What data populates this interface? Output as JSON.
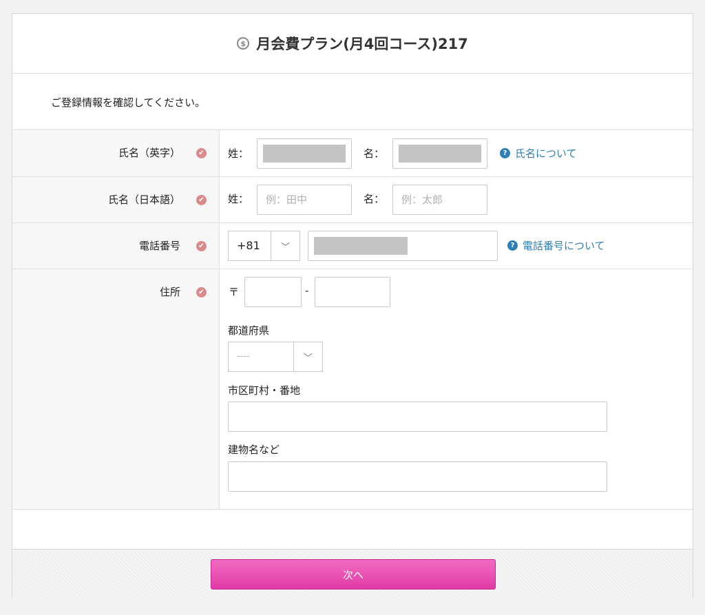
{
  "header": {
    "plan_icon": "dollar-circle-icon",
    "title": "月会費プラン(月4回コース)217"
  },
  "intro": "ご登録情報を確認してください。",
  "rows": {
    "name_en": {
      "label": "氏名（英字）",
      "last_label": "姓：",
      "first_label": "名：",
      "help": "氏名について"
    },
    "name_ja": {
      "label": "氏名（日本語）",
      "last_label": "姓：",
      "first_label": "名：",
      "last_placeholder": "例：田中",
      "first_placeholder": "例：太郎"
    },
    "phone": {
      "label": "電話番号",
      "country_code": "+81",
      "help": "電話番号について"
    },
    "address": {
      "label": "住所",
      "postal_mark": "〒",
      "postal_sep": "-",
      "prefecture_label": "都道府県",
      "prefecture_value": "----",
      "city_label": "市区町村・番地",
      "building_label": "建物名など"
    }
  },
  "required_icon": "check-circle-icon",
  "help_icon": "question-circle-icon",
  "footer": {
    "next_label": "次へ"
  },
  "colors": {
    "accent": "#e23aa6",
    "link": "#2f7fb5",
    "required": "#d98b8b"
  }
}
